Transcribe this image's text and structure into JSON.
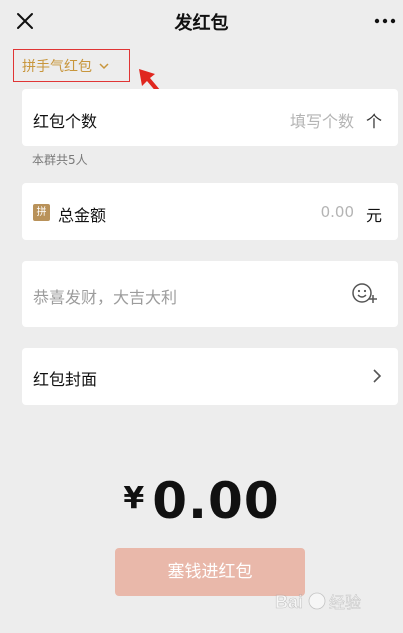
{
  "header": {
    "title": "发红包"
  },
  "type_selector": {
    "label": "拼手气红包"
  },
  "count_card": {
    "label": "红包个数",
    "placeholder": "填写个数",
    "unit": "个"
  },
  "member_note": "本群共5人",
  "total_card": {
    "badge": "拼",
    "label": "总金额",
    "placeholder": "0.00",
    "unit": "元"
  },
  "message_card": {
    "placeholder": "恭喜发财，大吉大利"
  },
  "cover_card": {
    "label": "红包封面"
  },
  "amount_display": {
    "currency": "¥",
    "value": "0.00"
  },
  "send_button": {
    "label": "塞钱进红包"
  },
  "watermark": {
    "text": "Bai 经验"
  },
  "colors": {
    "background": "#ededed",
    "accent_gold": "#c8963c",
    "send_button": "#e9b8aa",
    "annotation_red": "#e03535"
  },
  "icons": [
    "close-icon",
    "more-icon",
    "chevron-down-icon",
    "emoji-icon",
    "chevron-right-icon"
  ]
}
